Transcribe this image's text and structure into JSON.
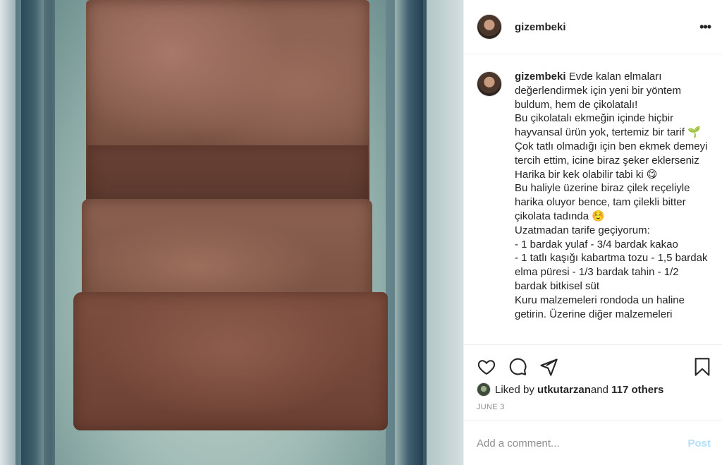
{
  "header": {
    "username": "gizembeki",
    "more_icon": "more-options-icon"
  },
  "caption": {
    "username": "gizembeki",
    "text": "Evde kalan elmaları değerlendirmek için yeni bir yöntem buldum, hem de çikolatalı!\nBu çikolatalı ekmeğin içinde hiçbir hayvansal ürün yok, tertemiz bir tarif 🌱\nÇok tatlı olmadığı için ben ekmek demeyi tercih ettim, icine biraz şeker eklerseniz Harika bir kek olabilir tabi ki 😋\nBu haliyle üzerine biraz çilek reçeliyle harika oluyor bence, tam çilekli bitter çikolata tadında ☺️\nUzatmadan tarife geçiyorum:\n- 1 bardak yulaf - 3/4 bardak kakao\n- 1 tatlı kaşığı kabartma tozu - 1,5 bardak elma püresi - 1/3 bardak tahin - 1/2 bardak bitkisel süt\nKuru malzemeleri rondoda un haline getirin. Üzerine diğer malzemeleri"
  },
  "actions": {
    "like_icon": "heart-icon",
    "comment_icon": "comment-icon",
    "share_icon": "share-icon",
    "save_icon": "bookmark-icon"
  },
  "likes": {
    "prefix": "Liked by ",
    "user": "utkutarzan",
    "middle": " and ",
    "others": "117 others"
  },
  "date": "JUNE 3",
  "comment_box": {
    "placeholder": "Add a comment...",
    "post_label": "Post"
  },
  "colors": {
    "post_button_disabled": "#b2dffc",
    "secondary_text": "#8e8e8e",
    "border": "#efefef"
  }
}
